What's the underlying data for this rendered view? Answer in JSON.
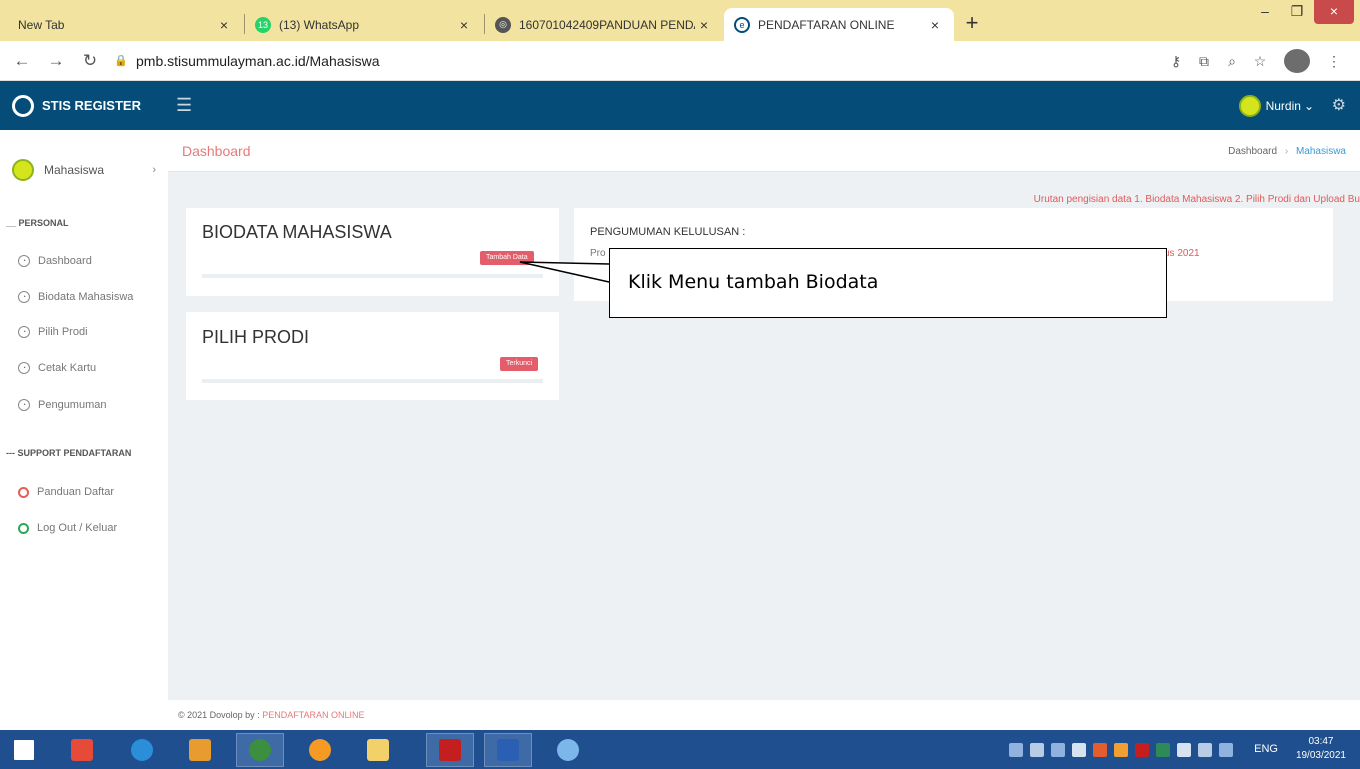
{
  "browser": {
    "tabs": [
      {
        "title": "New Tab",
        "icon": "none",
        "active": false
      },
      {
        "title": "(13) WhatsApp",
        "icon": "whatsapp-icon",
        "badge": "13",
        "active": false
      },
      {
        "title": "160701042409PANDUAN PENDA",
        "icon": "globe-icon",
        "active": false
      },
      {
        "title": "PENDAFTARAN ONLINE",
        "icon": "site-icon",
        "active": true
      }
    ],
    "tab_close": "×",
    "new_tab": "+",
    "window": {
      "minimize": "–",
      "maximize": "❐",
      "close": "×"
    },
    "url": "pmb.stisummulayman.ac.id/Mahasiswa"
  },
  "app": {
    "brand": "STIS REGISTER",
    "user_name": "Nurdin",
    "user_caret": "⌄",
    "accent_color": "#054d78"
  },
  "sidebar": {
    "user": "Mahasiswa",
    "chevron": "›",
    "section_personal": "__ PERSONAL",
    "personal_items": [
      {
        "label": "Dashboard"
      },
      {
        "label": "Biodata Mahasiswa"
      },
      {
        "label": "Pilih Prodi"
      },
      {
        "label": "Cetak Kartu"
      },
      {
        "label": "Pengumuman"
      }
    ],
    "section_support": "--- SUPPORT PENDAFTARAN",
    "support_items": [
      {
        "label": "Panduan Daftar",
        "color": "#e35d5d"
      },
      {
        "label": "Log Out / Keluar",
        "color": "#2fa55a"
      }
    ]
  },
  "main": {
    "page_title": "Dashboard",
    "breadcrumb": {
      "home": "Dashboard",
      "sep": "›",
      "current": "Mahasiswa"
    },
    "notice": "Urutan pengisian data 1. Biodata Mahasiswa 2. Pilih Prodi dan Upload Bu",
    "cards": {
      "biodata": {
        "title": "BIODATA MAHASISWA",
        "button": "Tambah Data"
      },
      "prodi": {
        "title": "PILIH PRODI",
        "button": "Terkunci"
      }
    },
    "announcement": {
      "title": "PENGUMUMAN KELULUSAN :",
      "prefix": "Pro",
      "suffix": "us 2021"
    }
  },
  "callout": {
    "text": "Klik Menu tambah  Biodata"
  },
  "footer": {
    "prefix": "© 2021 Dovolop by : ",
    "brand": "PENDAFTARAN ONLINE"
  },
  "taskbar": {
    "lang": "ENG",
    "time": "03:47",
    "date": "19/03/2021"
  }
}
